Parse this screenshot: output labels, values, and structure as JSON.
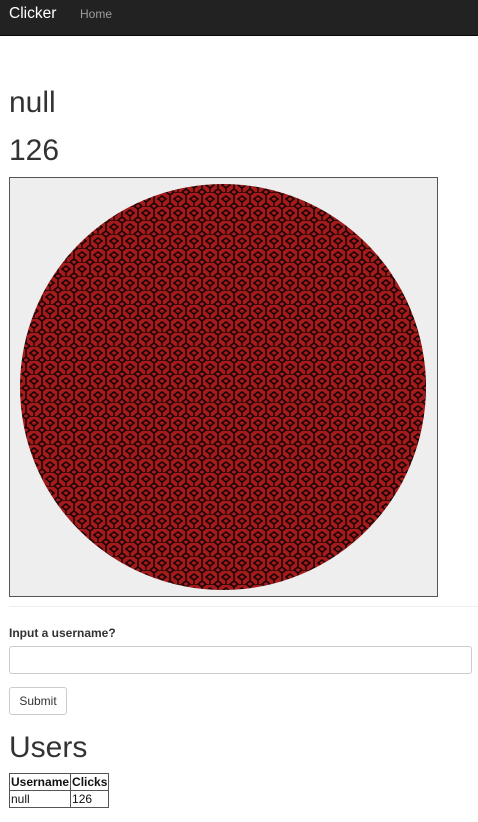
{
  "navbar": {
    "brand": "Clicker",
    "links": [
      "Home"
    ]
  },
  "current_user": "null",
  "click_count": "126",
  "clicker": {
    "button_color": "#a01818",
    "background_color": "#eeeeee",
    "pattern": "red hexagon-cube pattern"
  },
  "form": {
    "label": "Input a username?",
    "input_value": "",
    "submit_label": "Submit"
  },
  "users_section": {
    "title": "Users",
    "columns": [
      "Username",
      "Clicks"
    ],
    "rows": [
      [
        "null",
        "126"
      ]
    ]
  }
}
